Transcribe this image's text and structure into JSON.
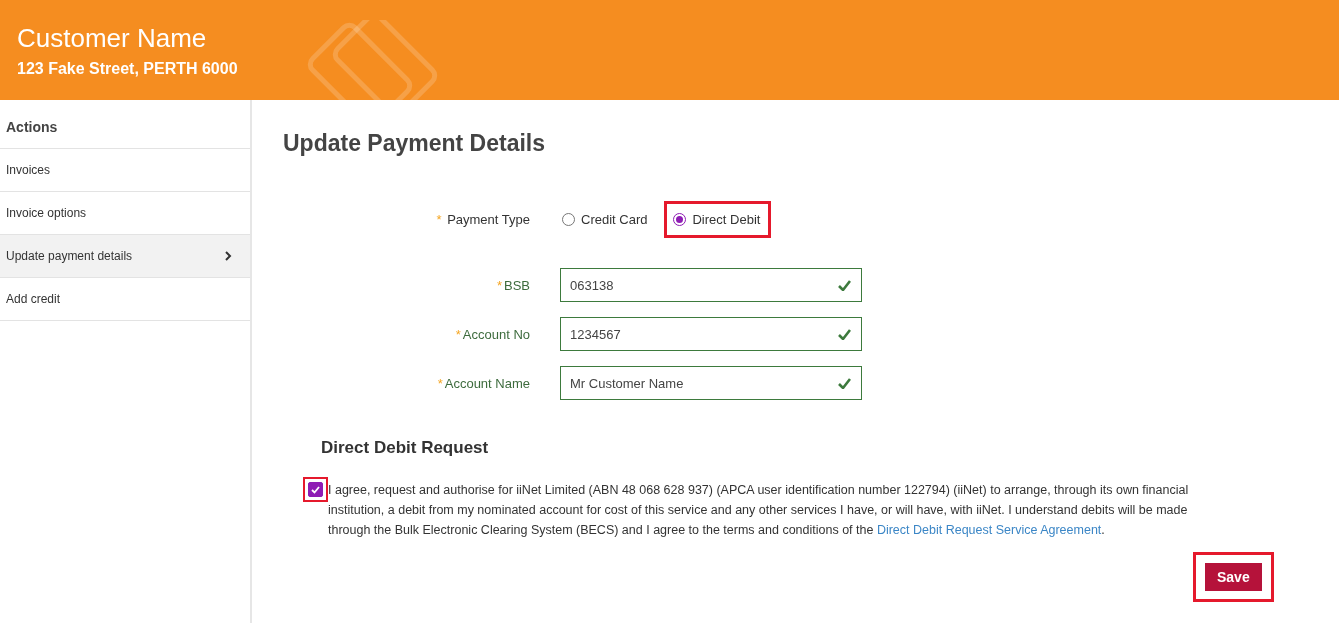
{
  "header": {
    "name": "Customer Name",
    "address": "123 Fake Street, PERTH 6000"
  },
  "sidebar": {
    "title": "Actions",
    "items": [
      {
        "label": "Invoices",
        "selected": false
      },
      {
        "label": "Invoice options",
        "selected": false
      },
      {
        "label": "Update payment details",
        "selected": true
      },
      {
        "label": "Add credit",
        "selected": false
      }
    ]
  },
  "page_title": "Update Payment Details",
  "payment_type": {
    "required": "*",
    "label": "Payment Type",
    "options": [
      {
        "label": "Credit Card",
        "selected": false,
        "highlighted": false
      },
      {
        "label": "Direct Debit",
        "selected": true,
        "highlighted": true
      }
    ]
  },
  "fields": [
    {
      "required": "*",
      "label": "BSB",
      "value": "063138",
      "valid": true
    },
    {
      "required": "*",
      "label": "Account No",
      "value": "1234567",
      "valid": true
    },
    {
      "required": "*",
      "label": "Account Name",
      "value": "Mr Customer Name",
      "valid": true
    }
  ],
  "ddr": {
    "title": "Direct Debit Request",
    "checked": true,
    "highlighted": true,
    "text": "I agree, request and authorise for iiNet Limited (ABN 48 068 628 937) (APCA user identification number 122794) (iiNet) to arrange, through its own financial institution, a debit from my nominated account for cost of this service and any other services I have, or will have, with iiNet. I understand debits will be made through the Bulk Electronic Clearing System (BECS) and I agree to the terms and conditions of the ",
    "link": "Direct Debit Request Service Agreement",
    "after": "."
  },
  "save": {
    "label": "Save",
    "highlighted": true
  }
}
